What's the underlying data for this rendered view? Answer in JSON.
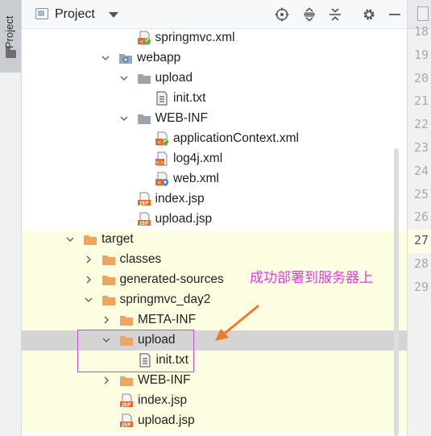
{
  "tool_window": {
    "label": "Project"
  },
  "header": {
    "title": "Project",
    "icons": [
      "locate-icon",
      "expand-all-icon",
      "collapse-all-icon",
      "gear-icon",
      "minimize-icon"
    ]
  },
  "tree": [
    {
      "label": "springmvc.xml",
      "icon": "xml-spring-icon",
      "indent": 1
    },
    {
      "label": "webapp",
      "icon": "web-folder-icon",
      "indent": 0,
      "expanded": true
    },
    {
      "label": "upload",
      "icon": "folder-gray-icon",
      "indent": 1,
      "expanded": true
    },
    {
      "label": "init.txt",
      "icon": "text-file-icon",
      "indent": 2
    },
    {
      "label": "WEB-INF",
      "icon": "folder-gray-icon",
      "indent": 1,
      "expanded": true
    },
    {
      "label": "applicationContext.xml",
      "icon": "xml-spring-icon",
      "indent": 2
    },
    {
      "label": "log4j.xml",
      "icon": "xml-file-icon",
      "indent": 2
    },
    {
      "label": "web.xml",
      "icon": "xml-web-icon",
      "indent": 2
    },
    {
      "label": "index.jsp",
      "icon": "jsp-file-icon",
      "indent": 1
    },
    {
      "label": "upload.jsp",
      "icon": "jsp-file-icon",
      "indent": 1
    },
    {
      "label": "target",
      "icon": "folder-orange-icon",
      "indent": 0,
      "expanded": true
    },
    {
      "label": "classes",
      "icon": "folder-orange-icon",
      "indent": 1,
      "expanded": false
    },
    {
      "label": "generated-sources",
      "icon": "folder-orange-icon",
      "indent": 1,
      "expanded": false
    },
    {
      "label": "springmvc_day2",
      "icon": "folder-orange-icon",
      "indent": 1,
      "expanded": true
    },
    {
      "label": "META-INF",
      "icon": "folder-orange-icon",
      "indent": 2,
      "expanded": false
    },
    {
      "label": "upload",
      "icon": "folder-orange-icon",
      "indent": 2,
      "expanded": true
    },
    {
      "label": "init.txt",
      "icon": "text-file-icon",
      "indent": 3
    },
    {
      "label": "WEB-INF",
      "icon": "folder-orange-icon",
      "indent": 2,
      "expanded": false
    },
    {
      "label": "index.jsp",
      "icon": "jsp-file-icon",
      "indent": 2
    },
    {
      "label": "upload.jsp",
      "icon": "jsp-file-icon",
      "indent": 2
    }
  ],
  "gutter": {
    "line_numbers": [
      "18",
      "19",
      "20",
      "21",
      "22",
      "23",
      "24",
      "25",
      "26",
      "27",
      "28",
      "29"
    ],
    "current_line": "27"
  },
  "annotation": {
    "text": "成功部署到服务器上",
    "color": "#e53ae0"
  },
  "colors": {
    "highlight_row": "#fdfde2",
    "selected_row": "#d4d4d4",
    "folder_orange": "#f0a55e",
    "folder_gray": "#9aa4ad"
  }
}
